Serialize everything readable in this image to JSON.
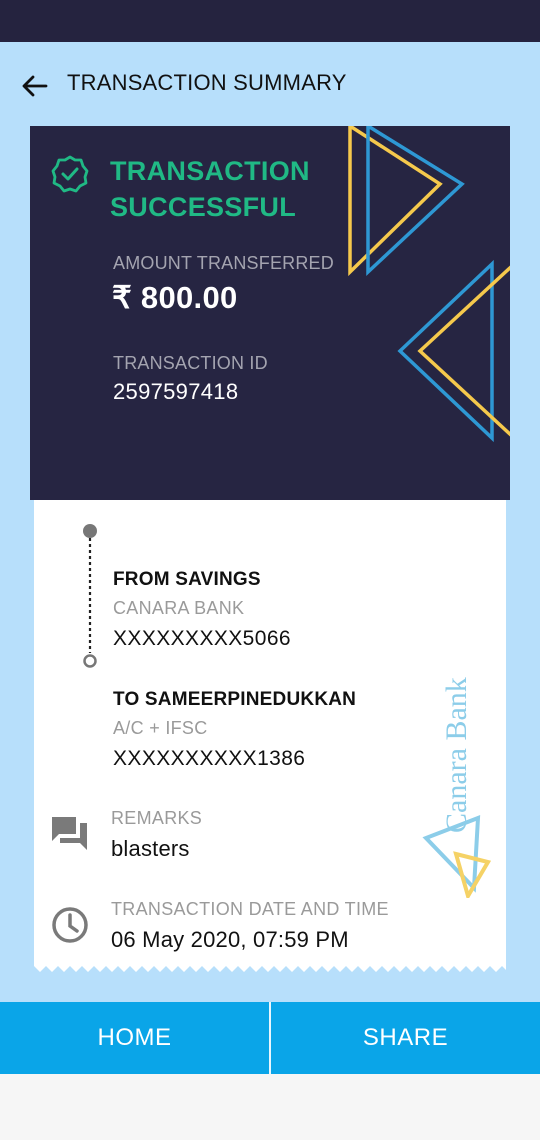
{
  "header": {
    "title": "TRANSACTION SUMMARY",
    "back_icon": "arrow-left-icon"
  },
  "status": {
    "title": "TRANSACTION SUCCESSFUL",
    "icon": "check-circle-icon",
    "color": "#20b985"
  },
  "amount": {
    "label": "AMOUNT TRANSFERRED",
    "value": "₹ 800.00"
  },
  "transaction": {
    "id_label": "TRANSACTION ID",
    "id_value": "2597597418"
  },
  "from": {
    "title": "FROM SAVINGS",
    "bank": "CANARA BANK",
    "account": "XXXXXXXXX5066"
  },
  "to": {
    "title": "TO SAMEERPINEDUKKAN",
    "type": "A/C + IFSC",
    "account": "XXXXXXXXXX1386"
  },
  "remarks": {
    "label": "REMARKS",
    "value": "blasters",
    "icon": "chat-bubbles-icon"
  },
  "datetime": {
    "label": "TRANSACTION DATE AND TIME",
    "value": "06 May 2020, 07:59 PM",
    "icon": "clock-icon"
  },
  "watermark": {
    "text": "Canara Bank"
  },
  "actions": {
    "home_label": "HOME",
    "share_label": "SHARE"
  },
  "colors": {
    "accent": "#0aa5e8",
    "hero_bg": "#262542",
    "page_bg": "#b7dffb",
    "deco_yellow": "#f5c94c",
    "deco_blue": "#2e98d4"
  }
}
